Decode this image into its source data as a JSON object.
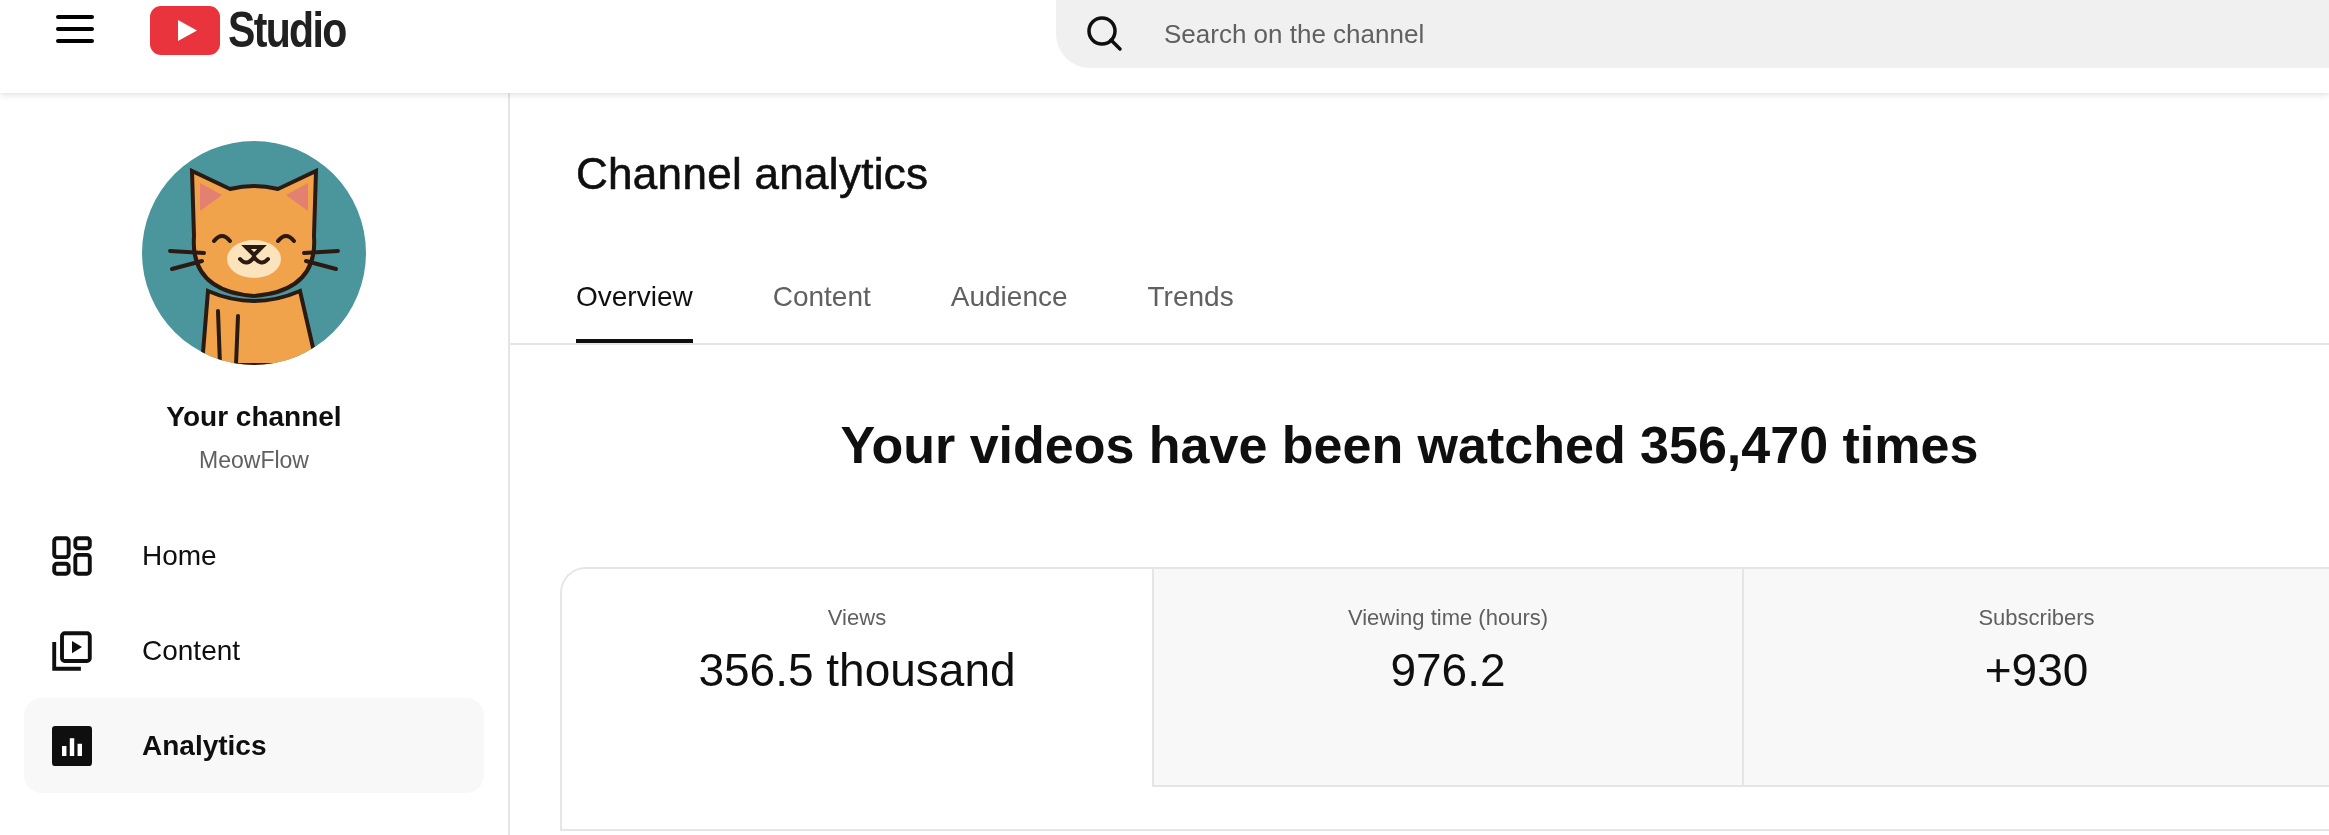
{
  "header": {
    "logo_text": "Studio",
    "search": {
      "placeholder": "Search on the channel"
    }
  },
  "sidebar": {
    "channel": {
      "title": "Your channel",
      "name": "MeowFlow"
    },
    "items": [
      {
        "label": "Home",
        "kind": "grid",
        "selected": false
      },
      {
        "label": "Content",
        "kind": "play",
        "selected": false
      },
      {
        "label": "Analytics",
        "kind": "bars",
        "selected": true
      }
    ]
  },
  "main": {
    "title": "Channel analytics",
    "tabs": [
      {
        "label": "Overview",
        "selected": true
      },
      {
        "label": "Content",
        "selected": false
      },
      {
        "label": "Audience",
        "selected": false
      },
      {
        "label": "Trends",
        "selected": false
      }
    ],
    "headline": "Your videos have been watched 356,470 times",
    "metrics": [
      {
        "label": "Views",
        "value": "356.5 thousand",
        "selected": true
      },
      {
        "label": "Viewing time (hours)",
        "value": "976.2",
        "selected": false
      },
      {
        "label": "Subscribers",
        "value": "+930",
        "selected": false
      }
    ]
  }
}
